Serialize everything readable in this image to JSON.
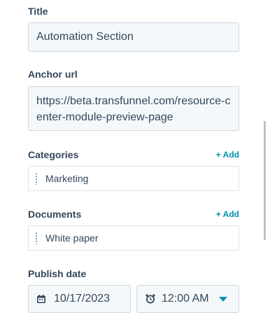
{
  "fields": {
    "title": {
      "label": "Title",
      "value": "Automation Section"
    },
    "anchor_url": {
      "label": "Anchor url",
      "value": "https://beta.transfunnel.com/resource-center-module-preview-page"
    },
    "categories": {
      "label": "Categories",
      "add_label": "+ Add",
      "items": [
        "Marketing"
      ]
    },
    "documents": {
      "label": "Documents",
      "add_label": "+ Add",
      "items": [
        "White paper"
      ]
    },
    "publish_date": {
      "label": "Publish date",
      "date": "10/17/2023",
      "time": "12:00 AM"
    }
  },
  "icons": {
    "drag_handle": "drag-handle-icon",
    "calendar": "calendar-icon",
    "clock": "clock-icon",
    "dropdown": "caret-down-icon"
  },
  "colors": {
    "label_text": "#33475b",
    "input_background": "#f5f8fa",
    "input_border": "#cbd6e2",
    "accent": "#0091ae"
  }
}
